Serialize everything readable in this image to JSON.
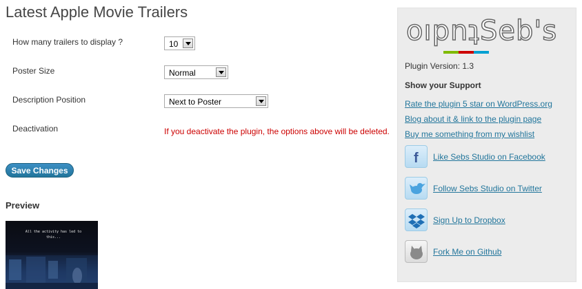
{
  "page": {
    "title": "Latest Apple Movie Trailers"
  },
  "settings": {
    "count": {
      "label": "How many trailers to display ?",
      "value": "10"
    },
    "poster_size": {
      "label": "Poster Size",
      "value": "Normal"
    },
    "description_position": {
      "label": "Description Position",
      "value": "Next to Poster"
    },
    "deactivation": {
      "label": "Deactivation",
      "warning": "If you deactivate the plugin, the options above will be deleted."
    }
  },
  "save_button": "Save Changes",
  "preview": {
    "heading": "Preview",
    "poster_text": "All the activity has led to this..."
  },
  "sidebar": {
    "logo_text": "oıpnʇSeb's",
    "logo_colors": [
      "#7fba00",
      "#cc0000",
      "#00a0d2"
    ],
    "version": "Plugin Version: 1.3",
    "support_heading": "Show your Support",
    "links": [
      "Rate the plugin 5 star on WordPress.org",
      "Blog about it & link to the plugin page",
      "Buy me something from my wishlist"
    ],
    "social": [
      {
        "icon": "facebook-icon",
        "label": "Like Sebs Studio on Facebook"
      },
      {
        "icon": "twitter-icon",
        "label": "Follow Sebs Studio on Twitter"
      },
      {
        "icon": "dropbox-icon",
        "label": "Sign Up to Dropbox"
      },
      {
        "icon": "github-icon",
        "label": "Fork Me on Github"
      }
    ]
  }
}
